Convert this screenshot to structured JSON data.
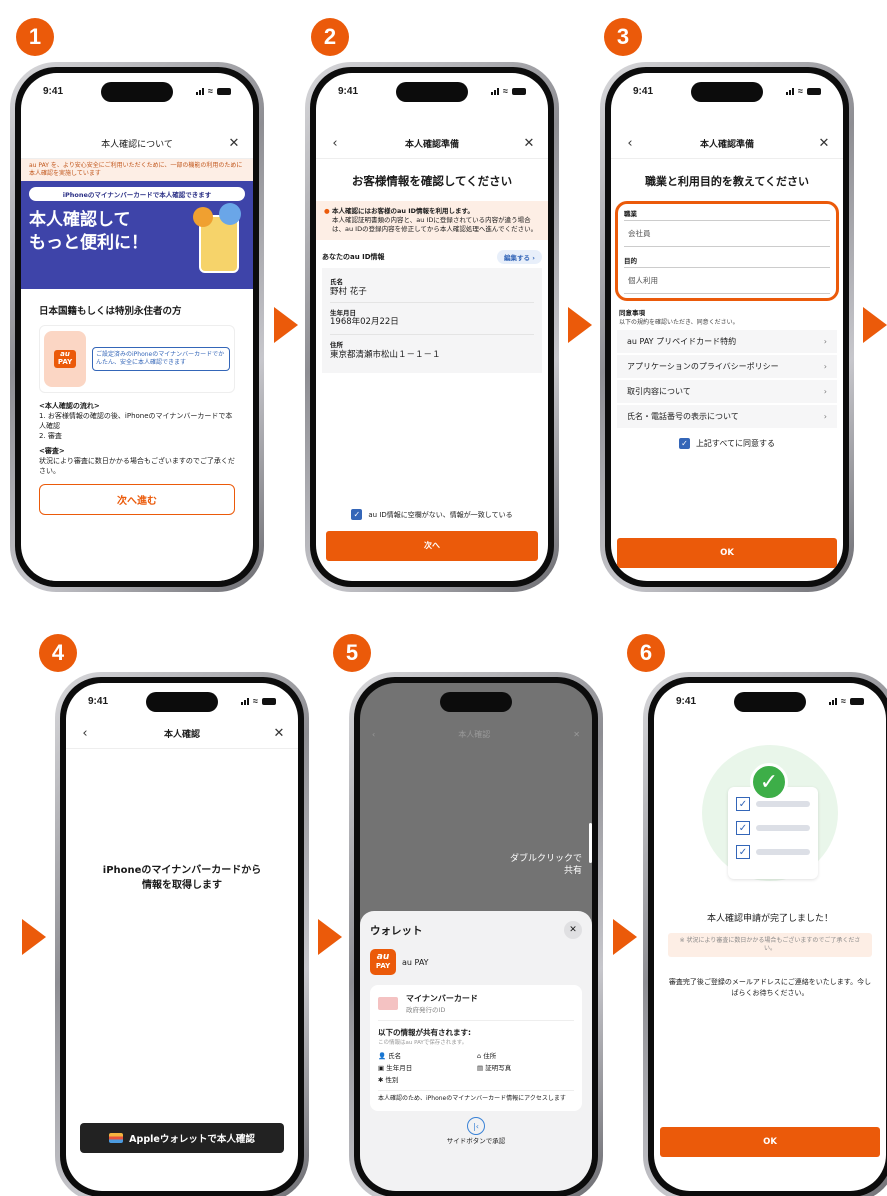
{
  "steps": [
    "1",
    "2",
    "3",
    "4",
    "5",
    "6"
  ],
  "status_time": "9:41",
  "accent": "#eb5a0a",
  "s1": {
    "title": "本人確認について",
    "notice": "au PAY を、より安心安全にご利用いただくために、一部の機能の利用のために本人確認を実施しています",
    "pill": "iPhoneのマイナンバーカードで本人確認できます",
    "hero_line1": "本人確認して",
    "hero_line2": "もっと便利に！",
    "card_heading": "日本国籍もしくは特別永住者の方",
    "illus_logo_top": "au",
    "illus_logo_bottom": "PAY",
    "illus_text": "ご設定済みのiPhoneのマイナンバーカードでかんたん、安全に本人確認できます",
    "flow_title": "<本人確認の流れ>",
    "flow_1": "1. お客様情報の確認の後、iPhoneのマイナンバーカードで本人確認",
    "flow_2": "2. 審査",
    "review_title": "<審査>",
    "review_text": "状況により審査に数日かかる場合もございますのでご了承ください。",
    "next_button": "次へ進む"
  },
  "s2": {
    "title": "本人確認準備",
    "heading": "お客様情報を確認してください",
    "alert_title": "本人確認にはお客様のau ID情報を利用します。",
    "alert_body": "本人確認証明書類の内容と、au IDに登録されている内容が違う場合は、au IDの登録内容を修正してから本人確認処理へ進んでください。",
    "section_label": "あなたのau ID情報",
    "edit_button": "編集する ›",
    "name_label": "氏名",
    "name_value": "野村 花子",
    "dob_label": "生年月日",
    "dob_value": "1968年02月22日",
    "address_label": "住所",
    "address_value": "東京都清瀬市松山１－１－１",
    "consent": "au ID情報に空欄がない、情報が一致している",
    "next_button": "次へ"
  },
  "s3": {
    "title": "本人確認準備",
    "heading": "職業と利用目的を教えてください",
    "job_label": "職業",
    "job_value": "会社員",
    "purpose_label": "目的",
    "purpose_value": "個人利用",
    "agree_title": "同意事項",
    "agree_sub": "以下の規約を確認いただき、同意ください。",
    "items": [
      "au PAY プリペイドカード特約",
      "アプリケーションのプライバシーポリシー",
      "取引内容について",
      "氏名・電話番号の表示について"
    ],
    "agree_all": "上記すべてに同意する",
    "ok_button": "OK"
  },
  "s4": {
    "title": "本人確認",
    "message_line1": "iPhoneのマイナンバーカードから",
    "message_line2": "情報を取得します",
    "wallet_button": "Appleウォレットで本人確認"
  },
  "s5": {
    "bg_title": "本人確認",
    "double_click_line1": "ダブルクリックで",
    "double_click_line2": "共有",
    "sheet_title": "ウォレット",
    "app_logo_top": "au",
    "app_logo_bottom": "PAY",
    "app_name": "au PAY",
    "card_name": "マイナンバーカード",
    "card_sub": "政府発行のID",
    "shared_title": "以下の情報が共有されます:",
    "shared_sub": "この情報はau PAYで保存されます。",
    "field_name": "氏名",
    "field_address": "住所",
    "field_dob": "生年月日",
    "field_photo": "証明写真",
    "field_sex": "性別",
    "footer_text": "本人確認のため、iPhoneのマイナンバーカード情報にアクセスします",
    "side_button": "サイドボタンで承認"
  },
  "s6": {
    "complete": "本人確認申請が完了しました！",
    "notice": "※ 状況により審査に数日かかる場合もございますのでご了承ください。",
    "body": "審査完了後ご登録のメールアドレスにご連絡をいたします。今しばらくお待ちください。",
    "ok_button": "OK"
  }
}
